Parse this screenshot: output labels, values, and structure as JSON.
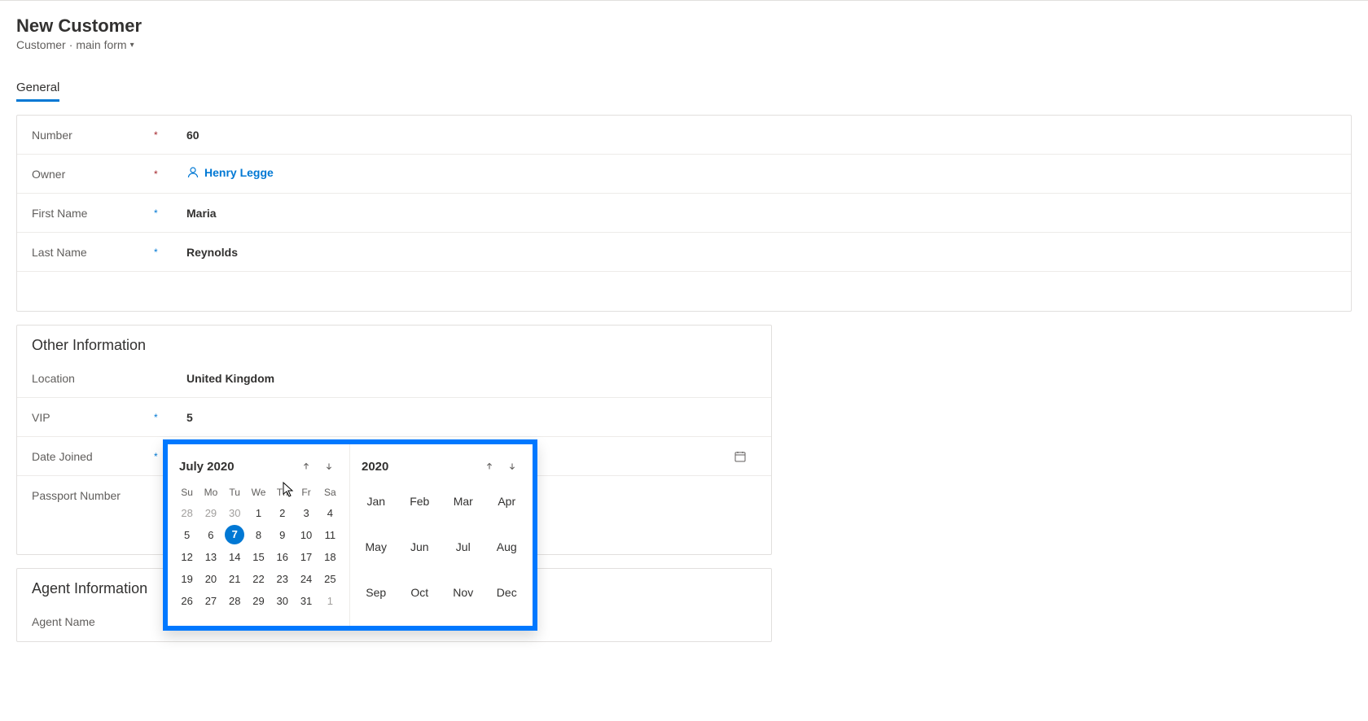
{
  "header": {
    "page_title": "New Customer",
    "breadcrumb_entity": "Customer",
    "breadcrumb_form": "main form"
  },
  "tabs": {
    "general": "General"
  },
  "general_section": {
    "number_label": "Number",
    "number_value": "60",
    "owner_label": "Owner",
    "owner_value": "Henry Legge",
    "first_name_label": "First Name",
    "first_name_value": "Maria",
    "last_name_label": "Last Name",
    "last_name_value": "Reynolds"
  },
  "other_section": {
    "title": "Other Information",
    "location_label": "Location",
    "location_value": "United Kingdom",
    "vip_label": "VIP",
    "vip_value": "5",
    "date_joined_label": "Date Joined",
    "date_joined_value": "---",
    "passport_label": "Passport Number",
    "passport_value": ""
  },
  "agent_section": {
    "title": "Agent Information",
    "agent_name_label": "Agent Name",
    "agent_name_value": ""
  },
  "datepicker": {
    "month_label": "July 2020",
    "year_label": "2020",
    "dow": [
      "Su",
      "Mo",
      "Tu",
      "We",
      "Th",
      "Fr",
      "Sa"
    ],
    "weeks": [
      [
        "28",
        "29",
        "30",
        "1",
        "2",
        "3",
        "4"
      ],
      [
        "5",
        "6",
        "7",
        "8",
        "9",
        "10",
        "11"
      ],
      [
        "12",
        "13",
        "14",
        "15",
        "16",
        "17",
        "18"
      ],
      [
        "19",
        "20",
        "21",
        "22",
        "23",
        "24",
        "25"
      ],
      [
        "26",
        "27",
        "28",
        "29",
        "30",
        "31",
        "1"
      ]
    ],
    "selected_day": "7",
    "prev_month_days": [
      "28",
      "29",
      "30"
    ],
    "next_month_days_tail": [
      "1"
    ],
    "months": [
      "Jan",
      "Feb",
      "Mar",
      "Apr",
      "May",
      "Jun",
      "Jul",
      "Aug",
      "Sep",
      "Oct",
      "Nov",
      "Dec"
    ]
  }
}
